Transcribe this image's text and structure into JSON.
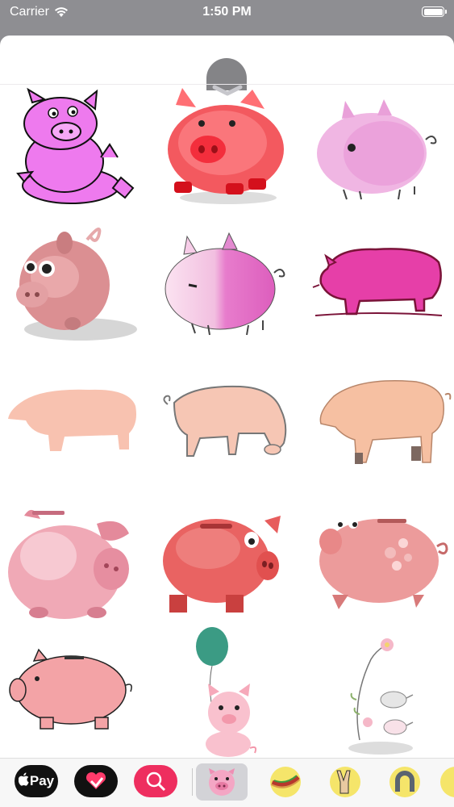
{
  "status_bar": {
    "carrier": "Carrier",
    "time": "1:50 PM"
  },
  "sheet": {
    "handle_icon": "chevron-down-icon"
  },
  "stickers": [
    {
      "icon": "cartoon-pig-sitting"
    },
    {
      "icon": "red-blurry-pig"
    },
    {
      "icon": "round-pink-pig"
    },
    {
      "icon": "3d-pink-pig-ball"
    },
    {
      "icon": "gradient-pink-pig"
    },
    {
      "icon": "sketch-magenta-pig"
    },
    {
      "icon": "pig-silhouette"
    },
    {
      "icon": "grazing-pig-outline"
    },
    {
      "icon": "realistic-farm-pig"
    },
    {
      "icon": "piggy-bank-shiny"
    },
    {
      "icon": "red-piggy-bank"
    },
    {
      "icon": "spotted-piggy-bank"
    },
    {
      "icon": "pink-piggy-bank-outline"
    },
    {
      "icon": "piglet-with-balloon"
    },
    {
      "icon": "flower-and-tiny-pigs"
    }
  ],
  "app_tray": {
    "apple_pay_label": "Pay",
    "items": [
      {
        "icon": "apple-pay-icon"
      },
      {
        "icon": "heart-sticker-icon"
      },
      {
        "icon": "image-search-icon"
      },
      {
        "icon": "pig-sticker-pack-icon",
        "selected": true
      },
      {
        "icon": "hotdog-sticker-icon"
      },
      {
        "icon": "peace-sign-sticker-icon"
      },
      {
        "icon": "horseshoe-sticker-icon"
      }
    ]
  }
}
